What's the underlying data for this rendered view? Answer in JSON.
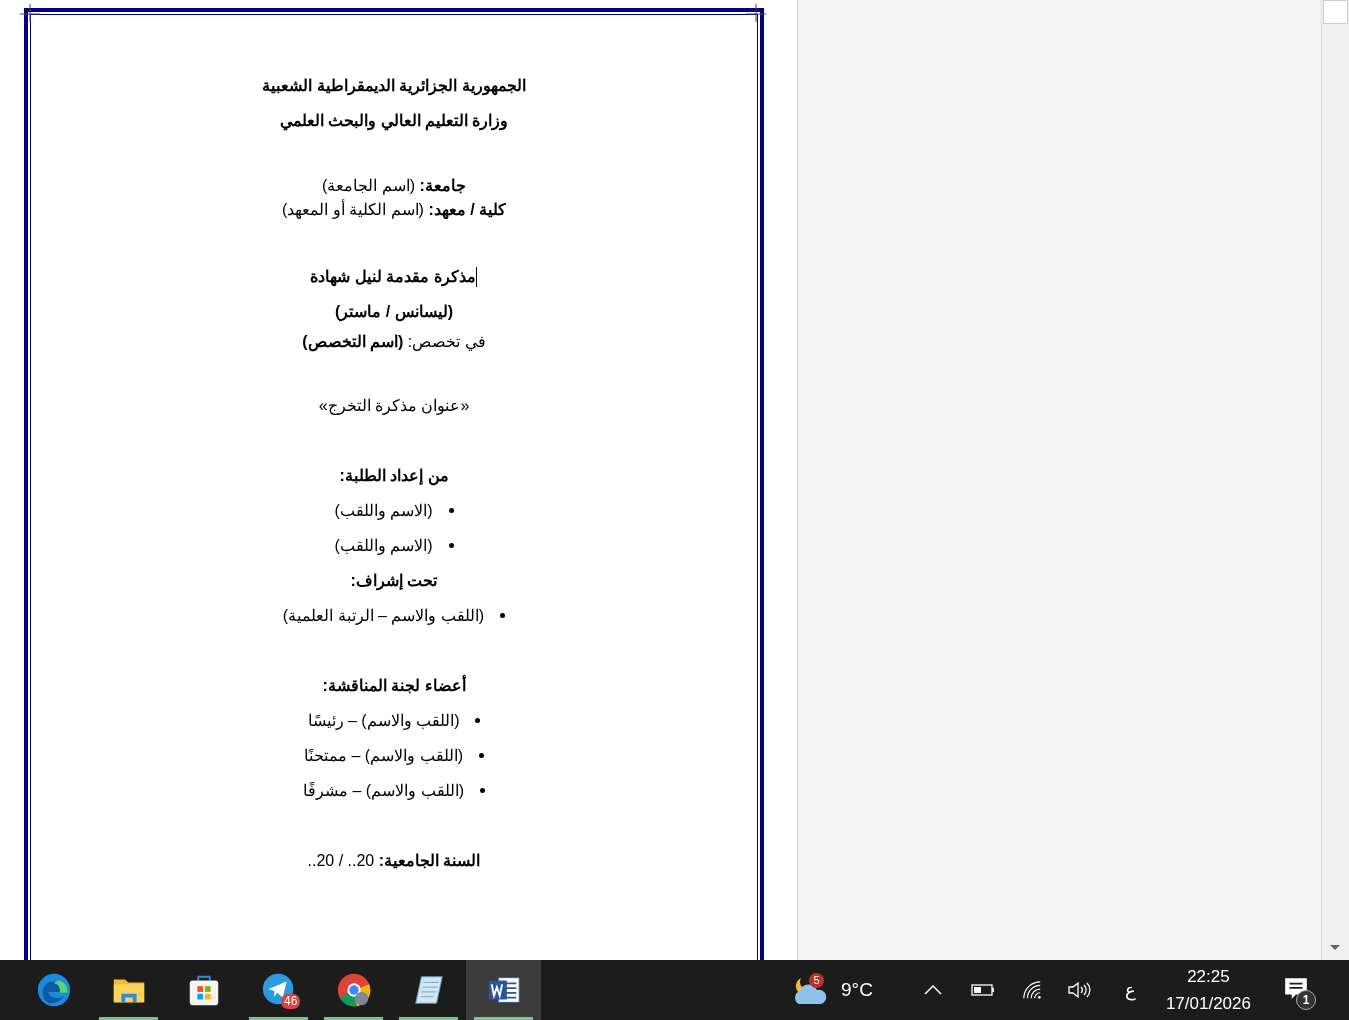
{
  "document": {
    "sections": [
      {
        "blocks": [
          {
            "kind": "paragraph",
            "bold": true,
            "text": "الجمهورية الجزائرية الديمقراطية الشعبية"
          },
          {
            "kind": "paragraph",
            "bold": true,
            "text": "وزارة التعليم العالي والبحث العلمي"
          }
        ]
      },
      {
        "blocks": [
          {
            "kind": "line",
            "bold": false,
            "text": "**جامعة:** (اسم الجامعة)"
          },
          {
            "kind": "line",
            "bold": false,
            "text": "**كلية / معهد:** (اسم الكلية أو المعهد)"
          }
        ]
      },
      {
        "blocks": [
          {
            "kind": "paragraph",
            "bold": true,
            "text": "مذكرة مقدمة لنيل شهادة",
            "cursor": true
          },
          {
            "kind": "paragraph",
            "bold": true,
            "text": "(ليسانس / ماستر)"
          },
          {
            "kind": "line",
            "bold": false,
            "text": "في تخصص: **(اسم التخصص)**"
          }
        ]
      },
      {
        "blocks": [
          {
            "kind": "paragraph",
            "bold": false,
            "text": "«عنوان مذكرة التخرج»"
          }
        ]
      },
      {
        "blocks": [
          {
            "kind": "paragraph",
            "bold": true,
            "text": "من إعداد الطلبة:"
          },
          {
            "kind": "bullet",
            "bold": false,
            "text": "(الاسم واللقب)"
          },
          {
            "kind": "bullet",
            "bold": false,
            "text": "(الاسم واللقب)"
          },
          {
            "kind": "paragraph",
            "bold": true,
            "text": "تحت إشراف:"
          },
          {
            "kind": "bullet",
            "bold": false,
            "text": "(اللقب والاسم – الرتبة العلمية)"
          }
        ]
      },
      {
        "blocks": [
          {
            "kind": "paragraph",
            "bold": true,
            "text": "أعضاء لجنة المناقشة:"
          },
          {
            "kind": "bullet",
            "bold": false,
            "text": "(اللقب والاسم) – رئيسًا"
          },
          {
            "kind": "bullet",
            "bold": false,
            "text": "(اللقب والاسم) – ممتحنًا"
          },
          {
            "kind": "bullet",
            "bold": false,
            "text": "(اللقب والاسم) – مشرفًا"
          }
        ]
      },
      {
        "blocks": [
          {
            "kind": "paragraph",
            "bold": false,
            "text": "**السنة الجامعية:** 20.. / 20.."
          }
        ]
      }
    ]
  },
  "taskbar": {
    "apps": [
      {
        "kind": "edge",
        "running": false,
        "selected": false
      },
      {
        "kind": "folder",
        "running": true,
        "selected": false
      },
      {
        "kind": "store",
        "running": false,
        "selected": false
      },
      {
        "kind": "telegram",
        "running": true,
        "selected": false,
        "badge": "46"
      },
      {
        "kind": "chrome",
        "running": true,
        "selected": false
      },
      {
        "kind": "notepad",
        "running": true,
        "selected": false
      },
      {
        "kind": "word",
        "running": true,
        "selected": true
      }
    ],
    "weather": {
      "badge": "5",
      "temperature": "9°C"
    },
    "language": "ع",
    "time": "22:25",
    "date": "17/01/2026",
    "notifications": "1"
  }
}
